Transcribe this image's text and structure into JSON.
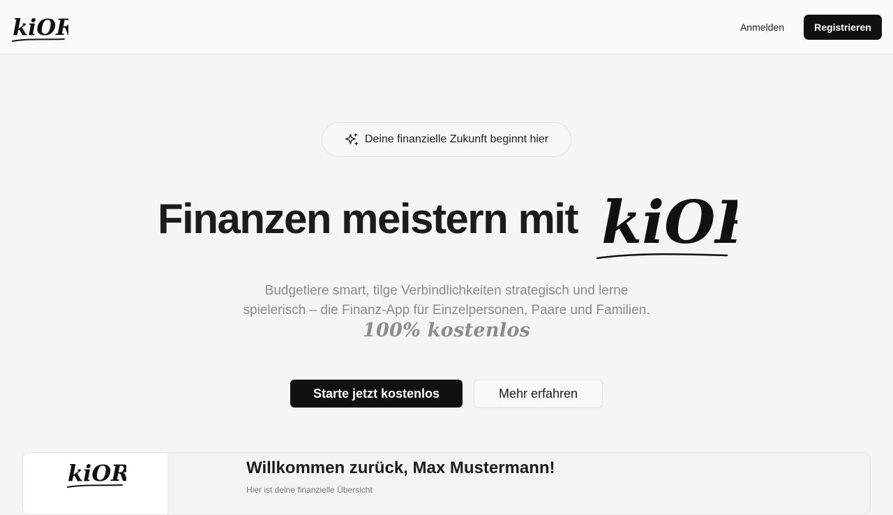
{
  "header": {
    "logo_text": "kiORI",
    "login_label": "Anmelden",
    "register_label": "Registrieren"
  },
  "hero": {
    "badge_icon": "sparkles-icon",
    "badge_text": "Deine finanzielle Zukunft beginnt hier",
    "title": "Finanzen meistern mit",
    "title_logo_text": "kiORI",
    "subtitle_line1": "Budgetiere smart, tilge Verbindlichkeiten strategisch und lerne",
    "subtitle_line2": "spielerisch – die Finanz-App für Einzelpersonen, Paare und Familien.",
    "free_tag": "100% kostenlos",
    "cta_primary": "Starte jetzt kostenlos",
    "cta_secondary": "Mehr erfahren"
  },
  "preview": {
    "logo_text": "kiORI",
    "welcome_title": "Willkommen zurück, Max Mustermann!",
    "welcome_subtitle": "Hier ist deine finanzielle Übersicht"
  },
  "colors": {
    "primary_button": "#111111",
    "page_background": "#f5f5f5",
    "muted_text": "#8a8a8a"
  }
}
